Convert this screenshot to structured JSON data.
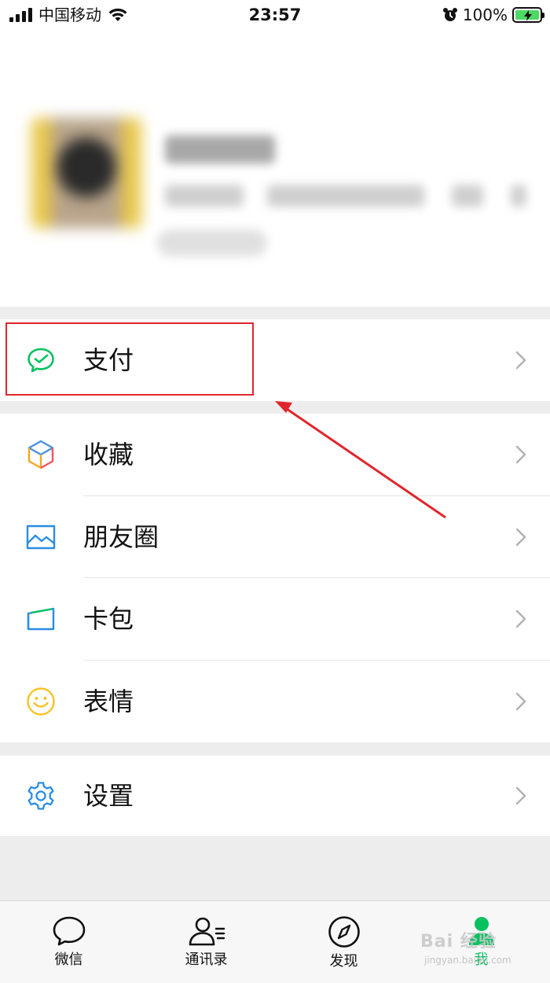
{
  "status_bar": {
    "carrier": "中国移动",
    "time": "23:57",
    "battery": "100%"
  },
  "menu": {
    "pay": {
      "label": "支付",
      "icon": "wechat-pay-icon"
    },
    "items": [
      {
        "label": "收藏",
        "icon": "favorites-cube-icon"
      },
      {
        "label": "朋友圈",
        "icon": "moments-image-icon"
      },
      {
        "label": "卡包",
        "icon": "card-wallet-icon"
      },
      {
        "label": "表情",
        "icon": "smiley-icon"
      }
    ],
    "settings": {
      "label": "设置",
      "icon": "gear-icon"
    }
  },
  "tabbar": {
    "tabs": [
      {
        "label": "微信",
        "icon": "chat-bubble-icon",
        "active": false
      },
      {
        "label": "通讯录",
        "icon": "contacts-icon",
        "active": false
      },
      {
        "label": "发现",
        "icon": "compass-icon",
        "active": false
      },
      {
        "label": "我",
        "icon": "me-person-icon",
        "active": true
      }
    ]
  },
  "watermark": {
    "text": "Bai 经验",
    "sub": "jingyan.baidu.com"
  },
  "colors": {
    "accent_green": "#07c160",
    "annotation_red": "#e0262c",
    "background": "#ededed"
  }
}
